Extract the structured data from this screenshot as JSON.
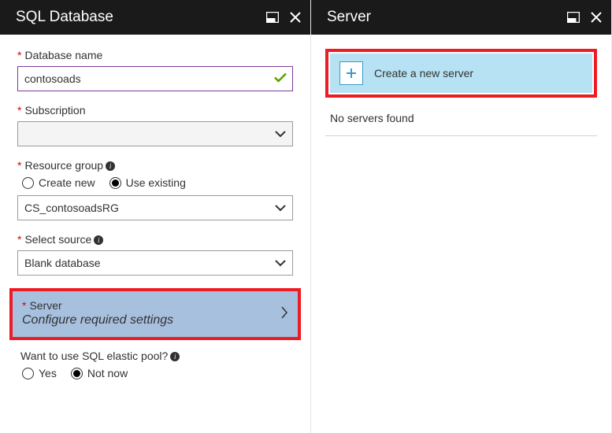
{
  "left": {
    "title": "SQL Database",
    "database_name_label": "Database name",
    "database_name_value": "contosoads",
    "subscription_label": "Subscription",
    "subscription_value": "",
    "resource_group_label": "Resource group",
    "rg_create_label": "Create new",
    "rg_existing_label": "Use existing",
    "rg_value": "CS_contosoadsRG",
    "select_source_label": "Select source",
    "select_source_value": "Blank database",
    "server_label": "Server",
    "server_sub": "Configure required settings",
    "elastic_label": "Want to use SQL elastic pool?",
    "elastic_yes": "Yes",
    "elastic_no": "Not now"
  },
  "right": {
    "title": "Server",
    "create_label": "Create a new server",
    "empty": "No servers found"
  }
}
